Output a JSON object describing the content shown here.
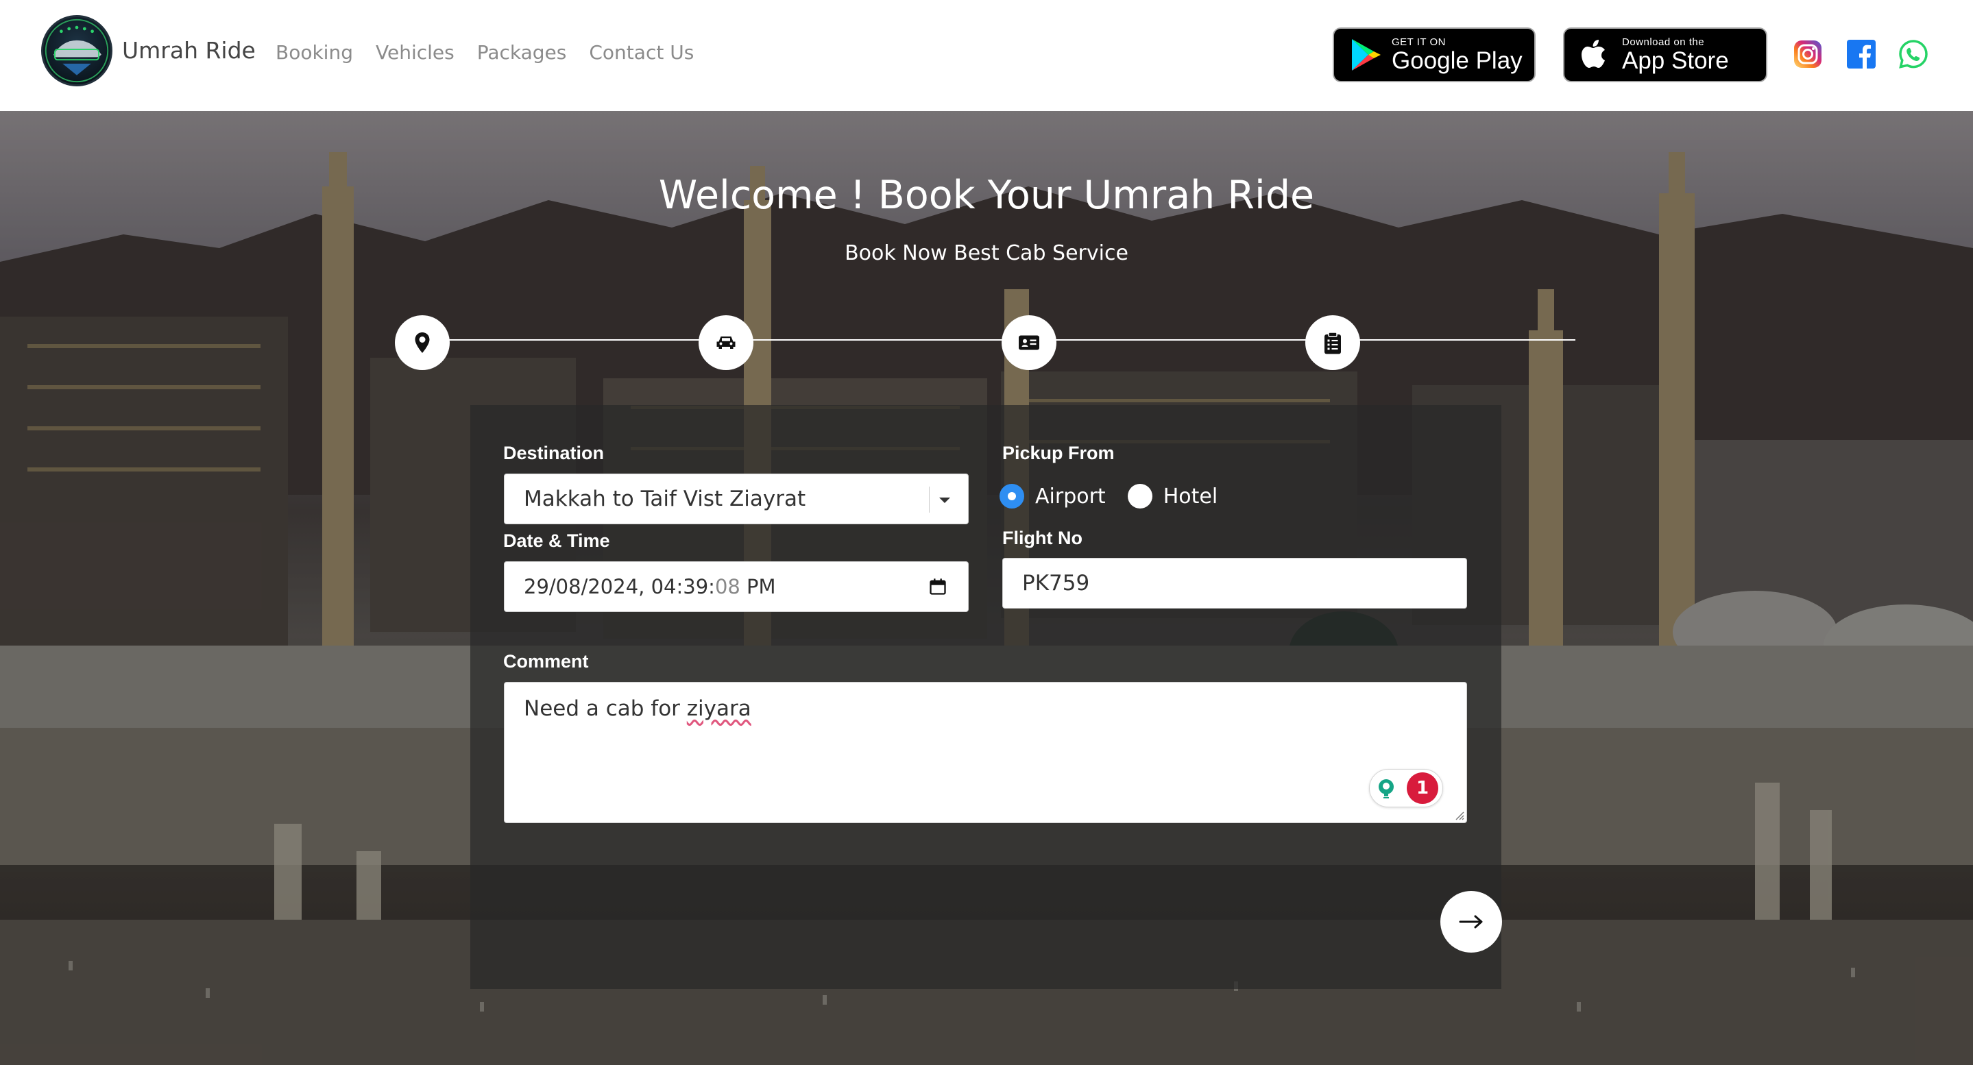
{
  "brand": {
    "name": "Umrah Ride",
    "logo_text": "UMRAH RIDE"
  },
  "nav": {
    "links": [
      {
        "label": "Booking"
      },
      {
        "label": "Vehicles"
      },
      {
        "label": "Packages"
      },
      {
        "label": "Contact Us"
      }
    ]
  },
  "stores": {
    "google": {
      "small": "GET IT ON",
      "big": "Google Play"
    },
    "apple": {
      "small": "Download on the",
      "big": "App Store"
    }
  },
  "social": [
    "instagram-icon",
    "facebook-icon",
    "whatsapp-icon"
  ],
  "hero": {
    "title": "Welcome ! Book Your Umrah Ride",
    "subtitle": "Book Now Best Cab Service"
  },
  "steps": [
    {
      "icon": "map-pin-icon"
    },
    {
      "icon": "car-icon"
    },
    {
      "icon": "id-card-icon"
    },
    {
      "icon": "clipboard-list-icon"
    }
  ],
  "form": {
    "destination": {
      "label": "Destination",
      "value": "Makkah to Taif Vist Ziayrat"
    },
    "datetime": {
      "label": "Date & Time",
      "value_main": "29/08/2024, 04:39:",
      "value_dim": "08",
      "value_tail": " PM"
    },
    "pickup": {
      "label": "Pickup From",
      "options": [
        {
          "label": "Airport",
          "checked": true
        },
        {
          "label": "Hotel",
          "checked": false
        }
      ]
    },
    "flight": {
      "label": "Flight No",
      "value": "PK759"
    },
    "comment": {
      "label": "Comment",
      "value_pre": "Need a cab for ",
      "value_flagged": "ziyara"
    },
    "grammar_count": "1"
  },
  "colors": {
    "radio_accent": "#2e8ef2",
    "grammar_badge": "#d81b3c",
    "whatsapp": "#25d366",
    "facebook": "#1877f2"
  }
}
